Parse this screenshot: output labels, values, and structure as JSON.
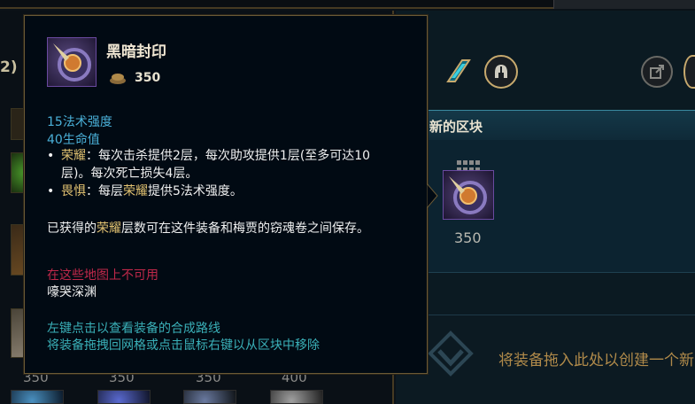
{
  "tooltip": {
    "item_name": "黑暗封印",
    "item_icon": "dark-seal-icon",
    "price": "350",
    "stats": [
      "15法术强度",
      "40生命值"
    ],
    "passives": [
      {
        "bullet": "•",
        "keyword": "荣耀",
        "text_line1": "：每次击杀提供2层，每次助攻提供1层(至多可达10",
        "text_line2": "层)。每次死亡损失4层。"
      },
      {
        "bullet": "•",
        "keyword": "畏惧",
        "text_prefix": "：每层",
        "inline_keyword": "荣耀",
        "text_suffix": "提供5法术强度。"
      }
    ],
    "note_prefix": "已获得的",
    "note_keyword": "荣耀",
    "note_suffix": "层数可在这件装备和梅贾的窃魂卷之间保存。",
    "unavailable_label": "在这些地图上不可用",
    "map_name": "嚎哭深渊",
    "hint_left_click": "左键点击以查看装备的合成路线",
    "hint_drag": "将装备拖拽回网格或点击鼠标右键以从区块中移除"
  },
  "left_panel": {
    "header_fragment": "2)",
    "bottom_prices": [
      "350",
      "350",
      "350",
      "400"
    ]
  },
  "right_panel": {
    "block_header": "新的区块",
    "block_item_price": "350",
    "drop_zone_text": "将装备拖入此处以创建一个新"
  },
  "colors": {
    "gold_border": "#c8aa6e",
    "stat_blue": "#4ab0d8",
    "keyword_gold": "#e0c070",
    "warning_red": "#c0284a",
    "hint_teal": "#3ab0b8"
  }
}
